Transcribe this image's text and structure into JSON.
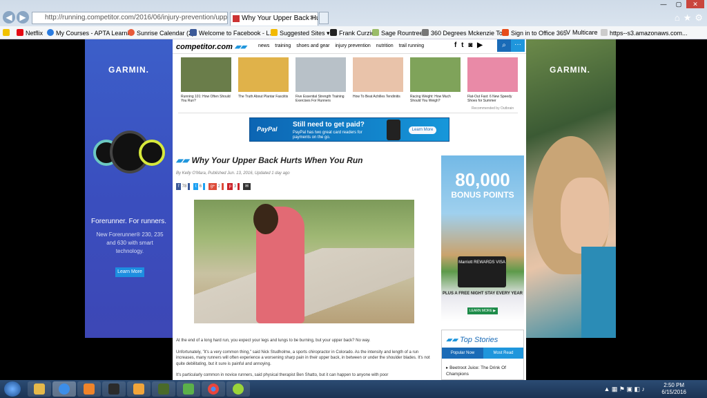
{
  "browser": {
    "address": "http://running.competitor.com/2016/06/injury-prevention/upp",
    "address_domain": "competitor.com",
    "tab_title": "Why Your Upper Back Hurts...",
    "favorites": [
      "Netflix",
      "My Courses - APTA Learni...",
      "Sunrise Calendar (2)",
      "Welcome to Facebook - L...",
      "Suggested Sites ▾",
      "Frank Curzio",
      "Sage Rountree",
      "360 Degrees Mckenzie To...",
      "Sign in to Office 365",
      "Multicare",
      "https--s3.amazonaws.com..."
    ]
  },
  "site": {
    "logo": "competitor.com",
    "nav": [
      "news",
      "training",
      "shoes and gear",
      "injury prevention",
      "nutrition",
      "trail running"
    ],
    "social": [
      "f",
      "t",
      "◙",
      "▶"
    ]
  },
  "recommended": [
    {
      "caption": "Running 101: How Often Should You Run?",
      "color": "#6a7d4a"
    },
    {
      "caption": "The Truth About Plantar Fasciitis",
      "color": "#e0b24a"
    },
    {
      "caption": "Five Essential Strength Training Exercises For Runners",
      "color": "#b8c1c8"
    },
    {
      "caption": "How To Beat Achilles Tendinitis",
      "color": "#e9c3aa"
    },
    {
      "caption": "Racing Weight: How Much Should You Weigh?",
      "color": "#7fa35a"
    },
    {
      "caption": "Flat-Out Fast: 6 New Speedy Shoes for Summer",
      "color": "#e98aa7"
    }
  ],
  "recommended_by": "Recommended by Outbrain",
  "paypal_ad": {
    "logo": "PayPal",
    "headline": "Still need to get paid?",
    "sub": "PayPal has two great card readers for payments on the go.",
    "button": "Learn More"
  },
  "article": {
    "title": "Why Your Upper Back Hurts When You Run",
    "byline": "By Kelly O'Mara, Published Jun. 13, 2016, Updated 1 day ago",
    "shares": [
      {
        "label": "f",
        "count": "78",
        "color": "#3b5998"
      },
      {
        "label": "t",
        "count": "6",
        "color": "#1da1f2"
      },
      {
        "label": "g+",
        "count": "2",
        "color": "#dd4b39"
      },
      {
        "label": "p",
        "count": "3",
        "color": "#cb2027"
      },
      {
        "label": "✉",
        "count": "",
        "color": "#333"
      }
    ],
    "paragraphs": [
      "At the end of a long hard run, you expect your legs and lungs to be burning, but your upper back? No way.",
      "Unfortunately, \"it's a very common thing,\" said Nick Studholme, a sports chiropractor in Colorado. As the intensity and length of a run increases, many runners will often experience a worsening sharp pain in their upper back, in between or under the shoulder blades. It's not quite debilitating, but it sure is painful and annoying.",
      "It's particularly common in novice runners, said physical therapist Ben Shatto, but it can happen to anyone with poor"
    ]
  },
  "garmin_ad": {
    "brand": "GARMIN.",
    "tagline": "Forerunner. For runners.",
    "sub": "New Forerunner® 230, 235 and 630 with smart technology.",
    "button": "Learn More"
  },
  "marriott_ad": {
    "big": "80,000",
    "points": "BONUS POINTS",
    "card": "Marriott REWARDS VISA",
    "plus": "PLUS A FREE NIGHT STAY EVERY YEAR",
    "button": "LEARN MORE ▶"
  },
  "top_stories": {
    "title": "Top Stories",
    "tab_popular": "Popular Now",
    "tab_most": "Most Read",
    "item": "Beetroot Juice: The Drink Of Champions"
  },
  "taskbar": {
    "time": "2:50 PM",
    "date": "6/15/2016"
  }
}
